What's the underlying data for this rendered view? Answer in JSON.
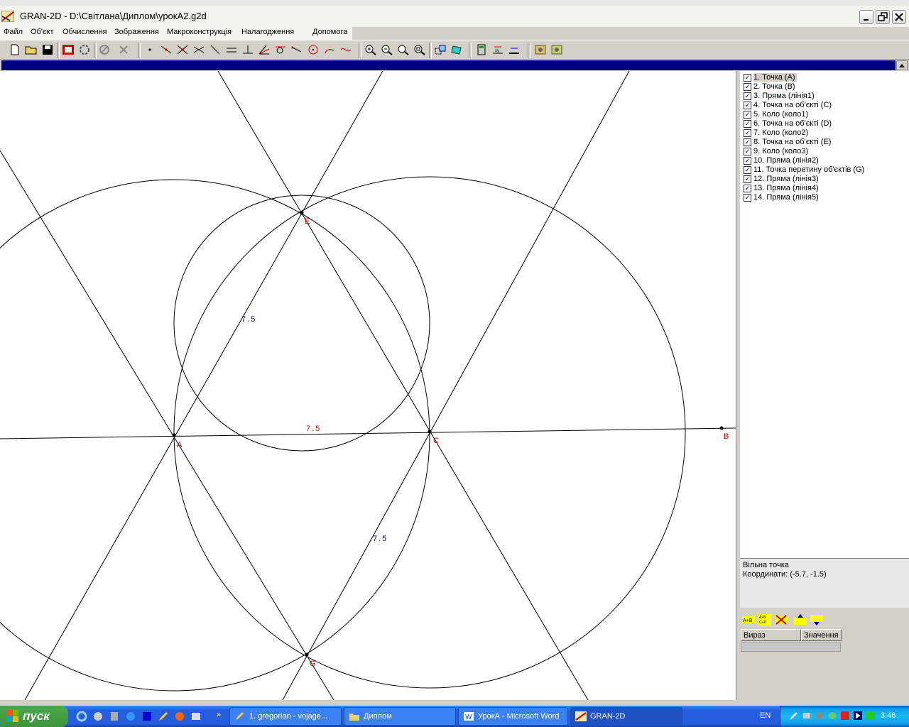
{
  "window": {
    "title": "GRAN-2D - D:\\Світлана\\Диплом\\урокА2.g2d"
  },
  "menu": [
    "Файл",
    "Об'єкт",
    "Обчислення",
    "Зображення",
    "Макроконструкція",
    "Налагодження",
    "Допомога"
  ],
  "toolbar": {
    "icons": [
      "new-file-icon",
      "open-folder-icon",
      "save-icon",
      "animation-icon",
      "refresh-icon",
      "cancel-icon",
      "delete-icon",
      "point-icon",
      "point-on-object-icon",
      "intersection-icon",
      "line-through-points-icon",
      "segment-icon",
      "parallel-line-icon",
      "perpendicular-icon",
      "bisector-icon",
      "tangent-icon",
      "ray-icon",
      "vector-icon",
      "circle-icon",
      "arc-icon",
      "curve-icon",
      "zoom-in-icon",
      "zoom-out-icon",
      "zoom-icon",
      "zoom-fit-icon",
      "transform-icon",
      "rotate-icon",
      "calculator-icon",
      "measure-icon",
      "ruler-icon",
      "settings-icon",
      "settings-alt-icon"
    ]
  },
  "drawing": {
    "points": [
      {
        "name": "A",
        "label_color": "#cc0000"
      },
      {
        "name": "B",
        "label_color": "#cc0000"
      },
      {
        "name": "C",
        "label_color": "#cc0000"
      },
      {
        "name": "E",
        "label_color": "#cc0000"
      },
      {
        "name": "G",
        "label_color": "#cc0000"
      }
    ],
    "measurements": [
      {
        "value": "7.5",
        "color": "#000080"
      },
      {
        "value": "7.5",
        "color": "#cc0000"
      },
      {
        "value": "7.5",
        "color": "#000080"
      }
    ]
  },
  "objects": [
    {
      "label": "1. Точка (A)",
      "checked": true,
      "selected": true
    },
    {
      "label": "2. Точка (B)",
      "checked": true
    },
    {
      "label": "3. Пряма (лінія1)",
      "checked": true
    },
    {
      "label": "4. Точка на об'єкті (C)",
      "checked": true
    },
    {
      "label": "5. Коло (коло1)",
      "checked": true
    },
    {
      "label": "6. Точка на об'єкті (D)",
      "checked": true
    },
    {
      "label": "7. Коло (коло2)",
      "checked": true
    },
    {
      "label": "8. Точка на об'єкті (E)",
      "checked": true
    },
    {
      "label": "9. Коло (коло3)",
      "checked": true
    },
    {
      "label": "10. Пряма (лінія2)",
      "checked": true
    },
    {
      "label": "11. Точка перетину об'єктів (G)",
      "checked": true
    },
    {
      "label": "12. Пряма (лінія3)",
      "checked": true
    },
    {
      "label": "13. Пряма (лінія4)",
      "checked": true
    },
    {
      "label": "14. Пряма (лінія5)",
      "checked": true
    }
  ],
  "info": {
    "line1": "Вільна точка",
    "line2": "Координати: (-5.7, -1.5)"
  },
  "expressions": {
    "col1": "Вираз",
    "col2": "Значення"
  },
  "taskbar": {
    "start": "пуск",
    "tasks": [
      {
        "label": "1. gregorian - vojage...",
        "active": false
      },
      {
        "label": "Диплом",
        "active": false
      },
      {
        "label": "УрокА - Microsoft Word",
        "active": false
      },
      {
        "label": "GRAN-2D",
        "active": true
      }
    ],
    "lang": "EN",
    "clock": "3:46"
  }
}
